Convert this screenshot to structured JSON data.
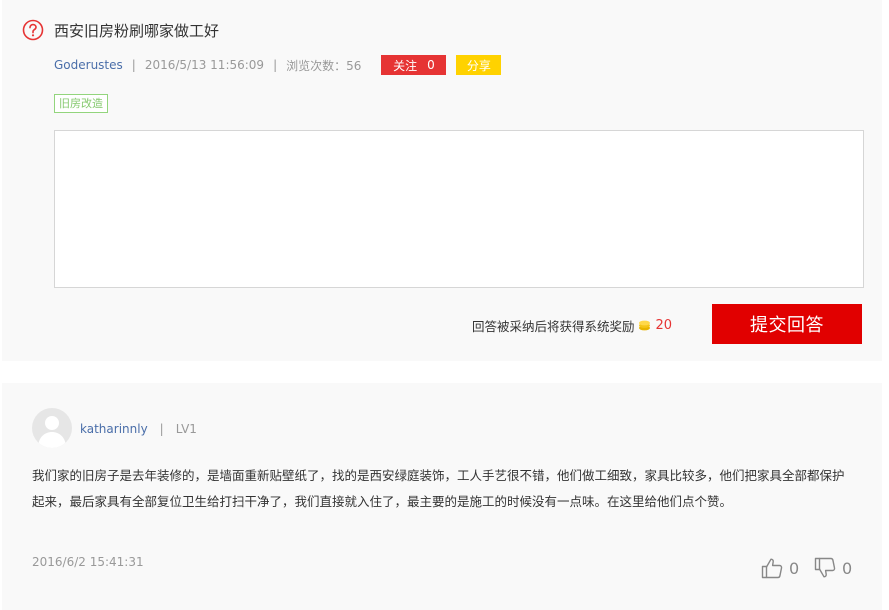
{
  "question": {
    "title": "西安旧房粉刷哪家做工好",
    "author": "Goderustes",
    "separator": "|",
    "datetime": "2016/5/13 11:56:09",
    "views": "浏览次数：56",
    "follow_label": "关注",
    "follow_count": "0",
    "share_label": "分享",
    "tag": "旧房改造"
  },
  "answer_form": {
    "reward_text": "回答被采纳后将获得系统奖励",
    "reward_amount": "20",
    "submit_label": "提交回答"
  },
  "answers": [
    {
      "user": "katharinnly",
      "separator": "|",
      "level": "LV1",
      "content": "我们家的旧房子是去年装修的，是墙面重新贴壁纸了，找的是西安绿庭装饰，工人手艺很不错，他们做工细致，家具比较多，他们把家具全部都保护起来，最后家具有全部复位卫生给打扫干净了，我们直接就入住了，最主要的是施工的时候没有一点味。在这里给他们点个赞。",
      "datetime": "2016/6/2 15:41:31",
      "likes": "0",
      "dislikes": "0"
    }
  ],
  "colors": {
    "accent_red": "#e10000",
    "follow_red": "#e63434",
    "share_yellow": "#ffd200",
    "link_blue": "#4a6ea9",
    "tag_green": "#86c96f"
  },
  "icons": {
    "question": "question-circle-icon",
    "coin": "coin-stack-icon",
    "like": "thumbs-up-icon",
    "dislike": "thumbs-down-icon",
    "avatar": "default-avatar"
  }
}
